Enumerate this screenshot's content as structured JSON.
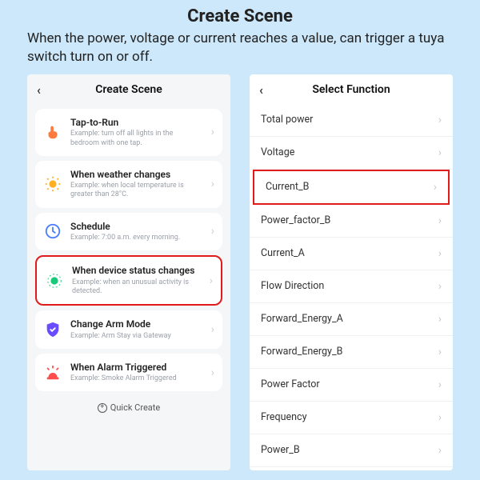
{
  "header": {
    "title": "Create Scene",
    "description": "When the power, voltage or current reaches a value, can trigger a tuya switch turn on or off."
  },
  "left_phone": {
    "title": "Create Scene",
    "items": [
      {
        "icon": "tap",
        "label": "Tap-to-Run",
        "example": "Example: turn off all lights in the bedroom with one tap.",
        "highlight": false
      },
      {
        "icon": "weather",
        "label": "When weather changes",
        "example": "Example: when local temperature is greater than 28°C.",
        "highlight": false
      },
      {
        "icon": "schedule",
        "label": "Schedule",
        "example": "Example: 7:00 a.m. every morning.",
        "highlight": false
      },
      {
        "icon": "device",
        "label": "When device status changes",
        "example": "Example: when an unusual activity is detected.",
        "highlight": true
      },
      {
        "icon": "arm",
        "label": "Change Arm Mode",
        "example": "Example: Arm Stay via Gateway",
        "highlight": false
      },
      {
        "icon": "alarm",
        "label": "When Alarm Triggered",
        "example": "Example: Smoke Alarm Triggered",
        "highlight": false
      }
    ],
    "quick_create": "Quick Create"
  },
  "right_phone": {
    "title": "Select Function",
    "items": [
      {
        "label": "Total power",
        "highlight": false
      },
      {
        "label": "Voltage",
        "highlight": false
      },
      {
        "label": "Current_B",
        "highlight": true
      },
      {
        "label": "Power_factor_B",
        "highlight": false
      },
      {
        "label": "Current_A",
        "highlight": false
      },
      {
        "label": "Flow Direction",
        "highlight": false
      },
      {
        "label": "Forward_Energy_A",
        "highlight": false
      },
      {
        "label": "Forward_Energy_B",
        "highlight": false
      },
      {
        "label": "Power Factor",
        "highlight": false
      },
      {
        "label": "Frequency",
        "highlight": false
      },
      {
        "label": "Power_B",
        "highlight": false
      }
    ]
  },
  "colors": {
    "highlight": "#e11b1b"
  }
}
